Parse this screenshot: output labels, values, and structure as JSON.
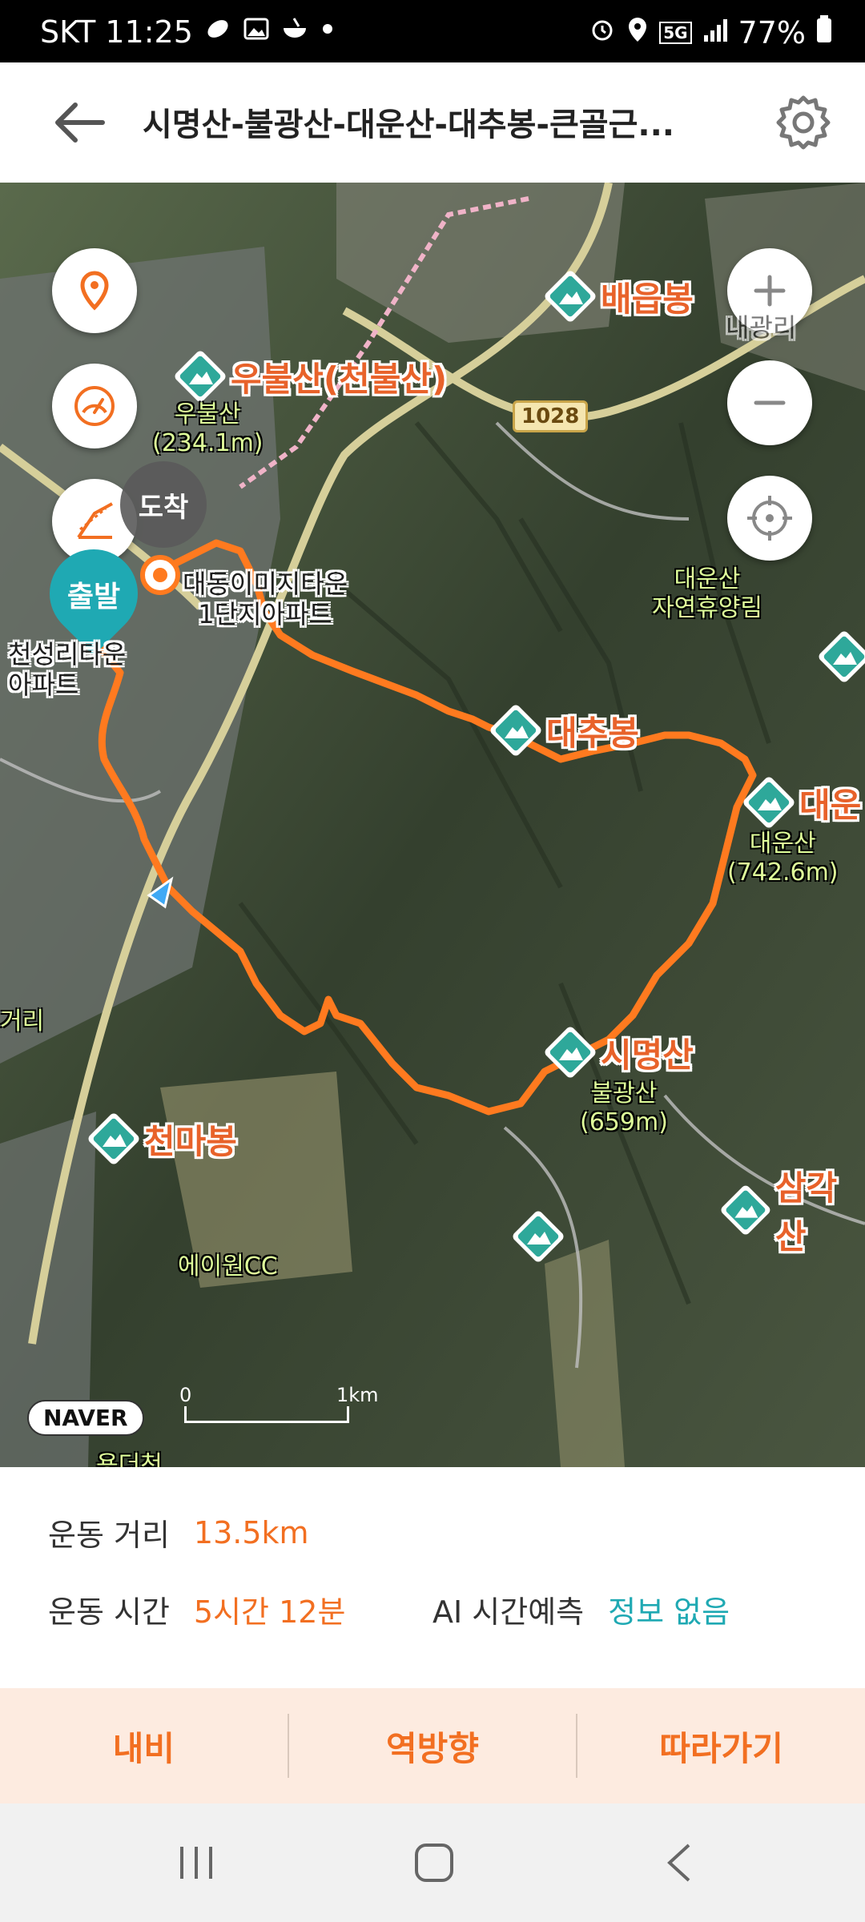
{
  "status": {
    "carrier_time": "SKT 11:25",
    "battery": "77%",
    "net": "5G"
  },
  "header": {
    "title": "시명산-불광산-대운산-대추봉-큰골근...",
    "back_icon": "arrow-left-icon",
    "settings_icon": "gear-icon"
  },
  "map": {
    "peaks": [
      {
        "name": "배읍봉"
      },
      {
        "name": "우불산(천불산)"
      },
      {
        "name": "대추봉"
      },
      {
        "name": "대운"
      },
      {
        "name": "시명산"
      },
      {
        "name": "천마봉"
      },
      {
        "name": "삼각산"
      }
    ],
    "sublabels": {
      "ubulsan": "우불산\n(234.1m)",
      "daeunsan": "대운산\n(742.6m)",
      "bulgwangsan": "불광산\n(659m)"
    },
    "places": {
      "apt1": "대동이미지타운\n1단지아파트",
      "apt2": "천성리타운\n아파트",
      "forest": "대운산\n자연휴양림",
      "cc": "에이원CC",
      "naeri": "내광리",
      "cross": "거리",
      "bottom": "용더천"
    },
    "road_number": "1028",
    "arrive_label": "도착",
    "start_label": "출발",
    "scale": {
      "zero": "0",
      "one": "1km"
    },
    "logo": "NAVER"
  },
  "stats": {
    "distance_label": "운동 거리",
    "distance_value": "13.5km",
    "time_label": "운동 시간",
    "time_value": "5시간 12분",
    "ai_label": "AI 시간예측",
    "ai_value": "정보 없음"
  },
  "actions": {
    "navigate": "내비",
    "reverse": "역방향",
    "follow": "따라가기"
  },
  "colors": {
    "accent": "#f26f21",
    "teal": "#1fa9b3"
  }
}
